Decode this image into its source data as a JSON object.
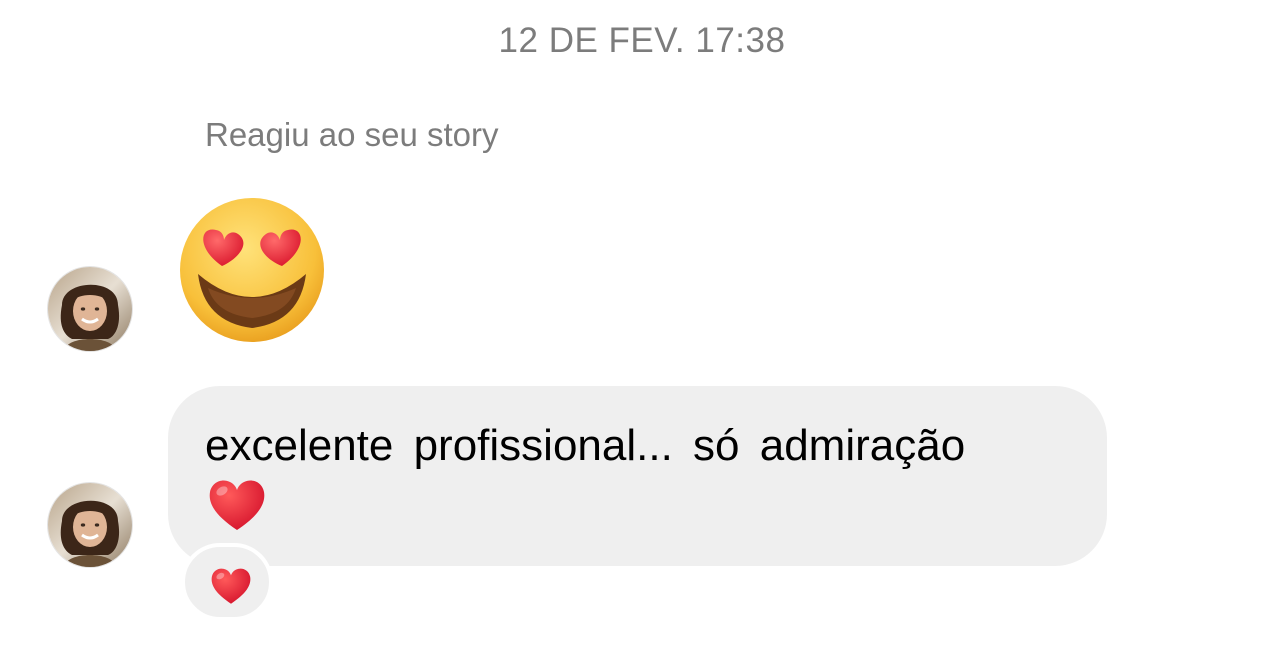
{
  "conversation": {
    "timestamp": "12 DE FEV. 17:38",
    "story_reaction_note": "Reagiu ao seu story"
  },
  "messages": [
    {
      "type": "emoji",
      "emoji_name": "smiling-face-with-heart-eyes",
      "emoji": "😍"
    },
    {
      "type": "text",
      "text": "excelente  profissional... só  admiração",
      "trailing_emoji_name": "red-heart",
      "trailing_emoji": "❤️",
      "reaction": {
        "emoji_name": "red-heart",
        "emoji": "❤️"
      }
    }
  ],
  "colors": {
    "meta_text": "#7c7c7c",
    "bubble_background": "#efefef",
    "heart_red": "#e0162b",
    "emoji_face": "#f6b73a"
  },
  "icons": {
    "avatar": "avatar-photo",
    "reaction": "heart-icon"
  }
}
